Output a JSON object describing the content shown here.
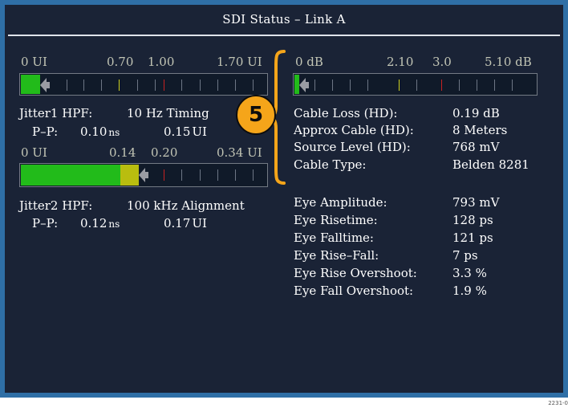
{
  "window": {
    "title": "SDI Status – Link A"
  },
  "jitter1": {
    "scale": {
      "l0": "0 UI",
      "l1": "0.70",
      "l2": "1.00",
      "l3": "1.70 UI"
    },
    "level": 0.08,
    "hpf_label": "Jitter1 HPF:",
    "hpf_value": "10 Hz Timing",
    "pp_label": "P–P:",
    "pp_ns_num": "0.10",
    "pp_ns_unit": "ns",
    "pp_ui_num": "0.15",
    "pp_ui_unit": "UI"
  },
  "jitter2": {
    "scale": {
      "l0": "0 UI",
      "l1": "0.14",
      "l2": "0.20",
      "l3": "0.34 UI"
    },
    "level": 0.48,
    "hpf_label": "Jitter2 HPF:",
    "hpf_value": "100 kHz Alignment",
    "pp_label": "P–P:",
    "pp_ns_num": "0.12",
    "pp_ns_unit": "ns",
    "pp_ui_num": "0.17",
    "pp_ui_unit": "UI"
  },
  "cable": {
    "scale": {
      "l0": "0 dB",
      "l1": "2.10",
      "l2": "3.0",
      "l3": "5.10 dB"
    },
    "level": 0.02,
    "rows": [
      {
        "label": "Cable Loss (HD):",
        "value": "0.19 dB"
      },
      {
        "label": "Approx Cable (HD):",
        "value": "8 Meters"
      },
      {
        "label": "Source Level (HD):",
        "value": "768 mV"
      },
      {
        "label": "Cable Type:",
        "value": "Belden 8281"
      }
    ]
  },
  "eye": {
    "rows": [
      {
        "label": "Eye Amplitude:",
        "value": "793 mV"
      },
      {
        "label": "Eye Risetime:",
        "value": "128 ps"
      },
      {
        "label": "Eye Falltime:",
        "value": "121 ps"
      },
      {
        "label": "Eye Rise–Fall:",
        "value": "7 ps"
      },
      {
        "label": "Eye Rise Overshoot:",
        "value": "3.3 %"
      },
      {
        "label": "Eye Fall Overshoot:",
        "value": "1.9 %"
      }
    ]
  },
  "callout": {
    "number": "5"
  },
  "footnote": "2231-0",
  "colors": {
    "fill_green": "#22bb1a",
    "fill_yellow": "#b9bd0f",
    "tick_yellow": "#cfd21f",
    "tick_red": "#c62222",
    "callout_orange": "#f5a51a"
  }
}
